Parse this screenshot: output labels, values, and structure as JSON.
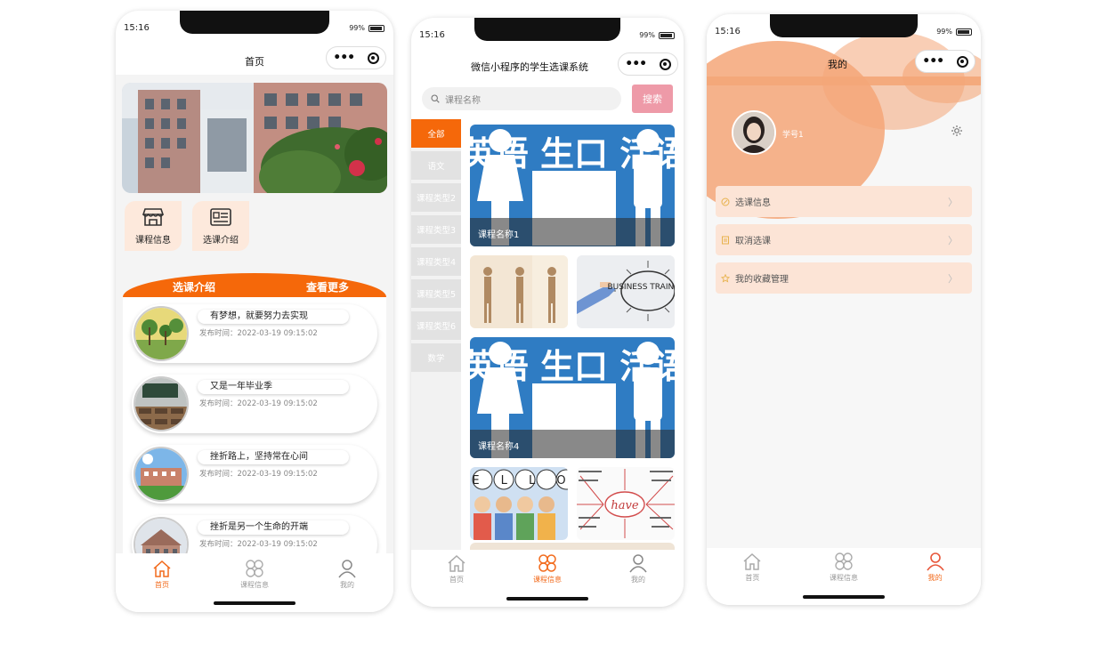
{
  "phone_home": {
    "status": {
      "time": "15:16",
      "battery": "99%"
    },
    "nav_title": "首页",
    "quick": [
      {
        "label": "课程信息"
      },
      {
        "label": "选课介绍"
      }
    ],
    "section": {
      "title": "选课介绍",
      "more": "查看更多"
    },
    "news": [
      {
        "title": "有梦想，就要努力去实现",
        "time": "发布时间：2022-03-19 09:15:02"
      },
      {
        "title": "又是一年毕业季",
        "time": "发布时间：2022-03-19 09:15:02"
      },
      {
        "title": "挫折路上，坚持常在心间",
        "time": "发布时间：2022-03-19 09:15:02"
      },
      {
        "title": "挫折是另一个生命的开端",
        "time": "发布时间：2022-03-19 09:15:02"
      }
    ]
  },
  "phone_courses": {
    "status": {
      "time": "15:16",
      "battery": "99%"
    },
    "nav_title": "微信小程序的学生选课系统",
    "search": {
      "placeholder": "课程名称",
      "button": "搜索"
    },
    "categories": [
      "全部",
      "语文",
      "课程类型2",
      "课程类型3",
      "课程类型4",
      "课程类型5",
      "课程类型6",
      "数学"
    ],
    "active_category": 0,
    "cards": [
      {
        "caption": "课程名称1",
        "art": "英语 生口 活语"
      },
      {
        "caption": "",
        "art": ""
      },
      {
        "caption": "",
        "art": "BUSINESS TRAINING"
      },
      {
        "caption": "课程名称4",
        "art": "英语 生口 活语"
      },
      {
        "caption": "",
        "art": "E L L O"
      },
      {
        "caption": "",
        "art": "have"
      }
    ]
  },
  "phone_mine": {
    "status": {
      "time": "15:16",
      "battery": "99%"
    },
    "nav_title": "我的",
    "username": "学号1",
    "menu": [
      {
        "label": "选课信息"
      },
      {
        "label": "取消选课"
      },
      {
        "label": "我的收藏管理"
      }
    ]
  },
  "tabbar": {
    "items": [
      {
        "label": "首页"
      },
      {
        "label": "课程信息"
      },
      {
        "label": "我的"
      }
    ]
  },
  "colors": {
    "accent": "#f5680a",
    "tab_active": "#f26a1b",
    "search_button": "#ee9aa8",
    "menu_bg": "#fce4d6",
    "orb": "#f4a678"
  }
}
